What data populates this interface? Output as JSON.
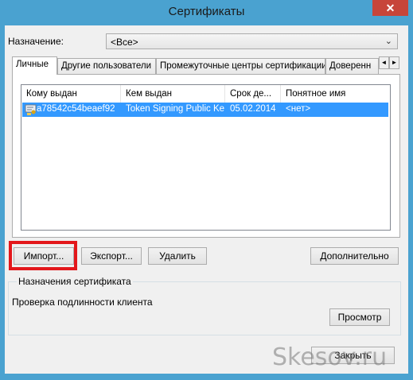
{
  "window": {
    "title": "Сертификаты",
    "close_label": "✕"
  },
  "purpose": {
    "label": "Назначение:",
    "value": "<Все>",
    "arrow": "⌄"
  },
  "tabs": [
    {
      "label": "Личные"
    },
    {
      "label": "Другие пользователи"
    },
    {
      "label": "Промежуточные центры сертификации"
    },
    {
      "label": "Доверенн"
    }
  ],
  "tab_scroll": {
    "left": "◄",
    "right": "►"
  },
  "list": {
    "headers": [
      "Кому выдан",
      "Кем выдан",
      "Срок де...",
      "Понятное имя"
    ],
    "rows": [
      {
        "issued_to": "a78542c54beaef92",
        "issued_by": "Token Signing Public Key",
        "expires": "05.02.2014",
        "friendly_name": "<нет>"
      }
    ]
  },
  "buttons": {
    "import": "Импорт...",
    "export": "Экспорт...",
    "delete": "Удалить",
    "advanced": "Дополнительно",
    "view": "Просмотр",
    "close": "Закрыть"
  },
  "cert_purposes": {
    "title": "Назначения сертификата",
    "value": "Проверка подлинности клиента"
  },
  "watermark": "Skesov.ru",
  "colors": {
    "frame": "#4aa2d0",
    "selection": "#3399ff",
    "highlight": "#e3171b",
    "close": "#c7453a"
  }
}
